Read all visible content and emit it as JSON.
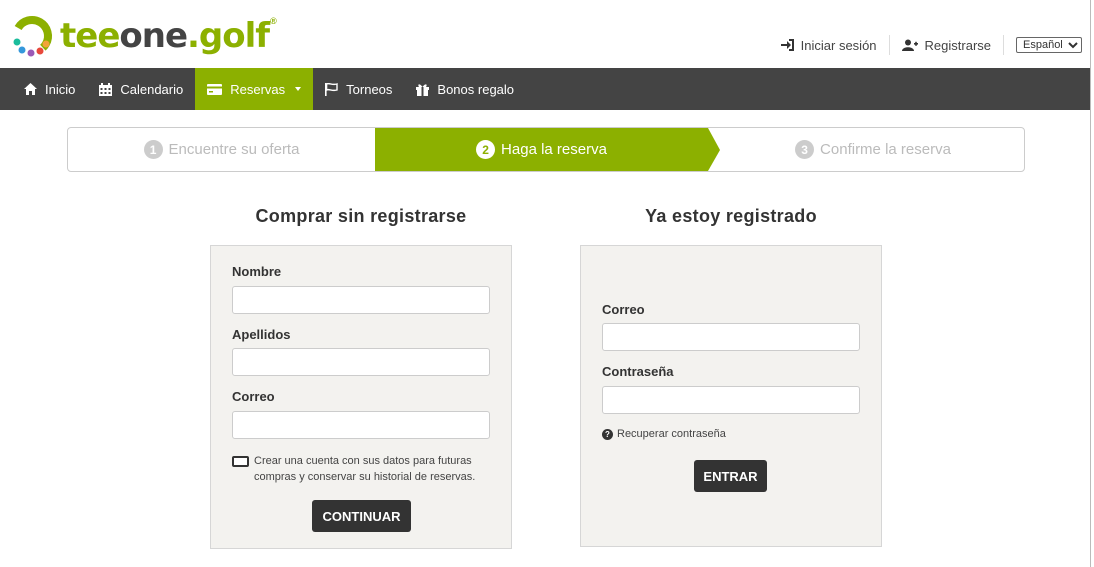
{
  "brand": {
    "logo_text_tee": "tee",
    "logo_text_one": "one",
    "logo_text_dot": ".",
    "logo_text_golf": "golf",
    "registered": "®",
    "accent_color": "#8cb000",
    "dark_color": "#444444"
  },
  "header": {
    "login_label": "Iniciar sesión",
    "login_icon": "sign-in-icon",
    "register_label": "Registrarse",
    "register_icon": "user-plus-icon",
    "language_selected": "Español"
  },
  "nav": {
    "items": [
      {
        "label": "Inicio",
        "icon": "home-icon"
      },
      {
        "label": "Calendario",
        "icon": "calendar-icon"
      },
      {
        "label": "Reservas",
        "icon": "credit-card-icon",
        "active": true
      },
      {
        "label": "Torneos",
        "icon": "flag-icon"
      },
      {
        "label": "Bonos regalo",
        "icon": "gift-icon"
      }
    ]
  },
  "steps": [
    {
      "number": "1",
      "label": "Encuentre su oferta",
      "state": "done"
    },
    {
      "number": "2",
      "label": "Haga la reserva",
      "state": "active"
    },
    {
      "number": "3",
      "label": "Confirme la reserva",
      "state": "pending"
    }
  ],
  "guest": {
    "title": "Comprar sin registrarse",
    "name_label": "Nombre",
    "name_value": "",
    "surname_label": "Apellidos",
    "surname_value": "",
    "email_label": "Correo",
    "email_value": "",
    "create_account_text": "Crear una cuenta con sus datos para futuras compras y conservar su historial de reservas.",
    "create_account_checked": false,
    "continue_label": "CONTINUAR"
  },
  "registered": {
    "title": "Ya estoy registrado",
    "email_label": "Correo",
    "email_value": "",
    "password_label": "Contraseña",
    "password_value": "",
    "recover_label": "Recuperar contraseña",
    "submit_label": "ENTRAR"
  }
}
